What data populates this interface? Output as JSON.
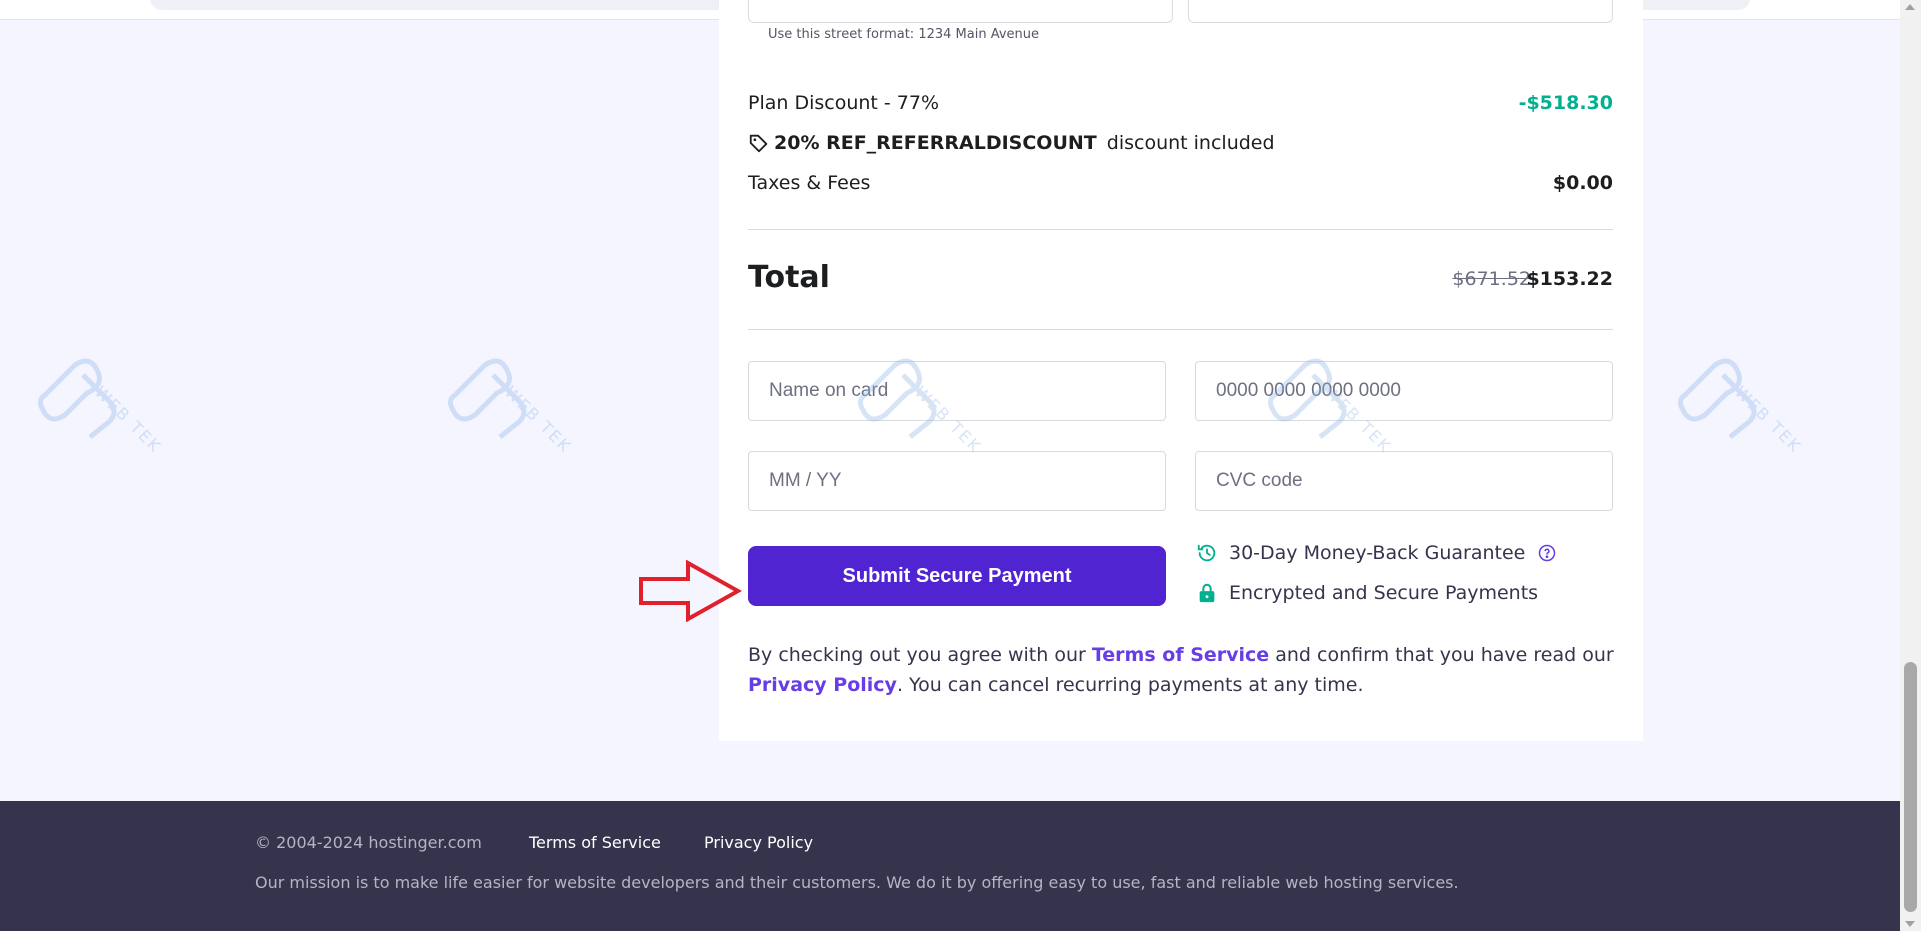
{
  "address": {
    "hint": "Use this street format: 1234 Main Avenue"
  },
  "summary": {
    "plan_discount_label": "Plan Discount - 77%",
    "plan_discount_value": "-$518.30",
    "coupon_code": "20% REF_REFERRALDISCOUNT",
    "coupon_suffix": " discount included",
    "taxes_label": "Taxes & Fees",
    "taxes_value": "$0.00",
    "total_label": "Total",
    "total_original": "$671.52",
    "total_value": "$153.22"
  },
  "payment_form": {
    "name_placeholder": "Name on card",
    "card_placeholder": "0000 0000 0000 0000",
    "expiry_placeholder": "MM / YY",
    "cvc_placeholder": "CVC code",
    "submit_label": "Submit Secure Payment"
  },
  "features": {
    "money_back": "30-Day Money-Back Guarantee",
    "secure": "Encrypted and Secure Payments"
  },
  "legal": {
    "prefix": "By checking out you agree with our ",
    "terms_link": "Terms of Service",
    "middle": " and confirm that you have read our ",
    "privacy_link": "Privacy Policy",
    "suffix": ". You can cancel recurring payments at any time."
  },
  "footer": {
    "copyright": "© 2004-2024 hostinger.com",
    "terms_link": "Terms of Service",
    "privacy_link": "Privacy Policy",
    "mission": "Our mission is to make life easier for website developers and their customers. We do it by offering easy to use, fast and reliable web hosting services."
  },
  "watermark": {
    "text": "WEB TEK"
  },
  "colors": {
    "brand": "#673de6",
    "button": "#5025d1",
    "discount": "#00b090",
    "footer_bg": "#36344d",
    "annotation_arrow": "#e0202a"
  },
  "icons": {
    "coupon": "tag-icon",
    "money_back": "history-icon",
    "money_back_info": "question-circle-icon",
    "secure": "lock-icon",
    "annotation": "arrow-right-icon"
  }
}
